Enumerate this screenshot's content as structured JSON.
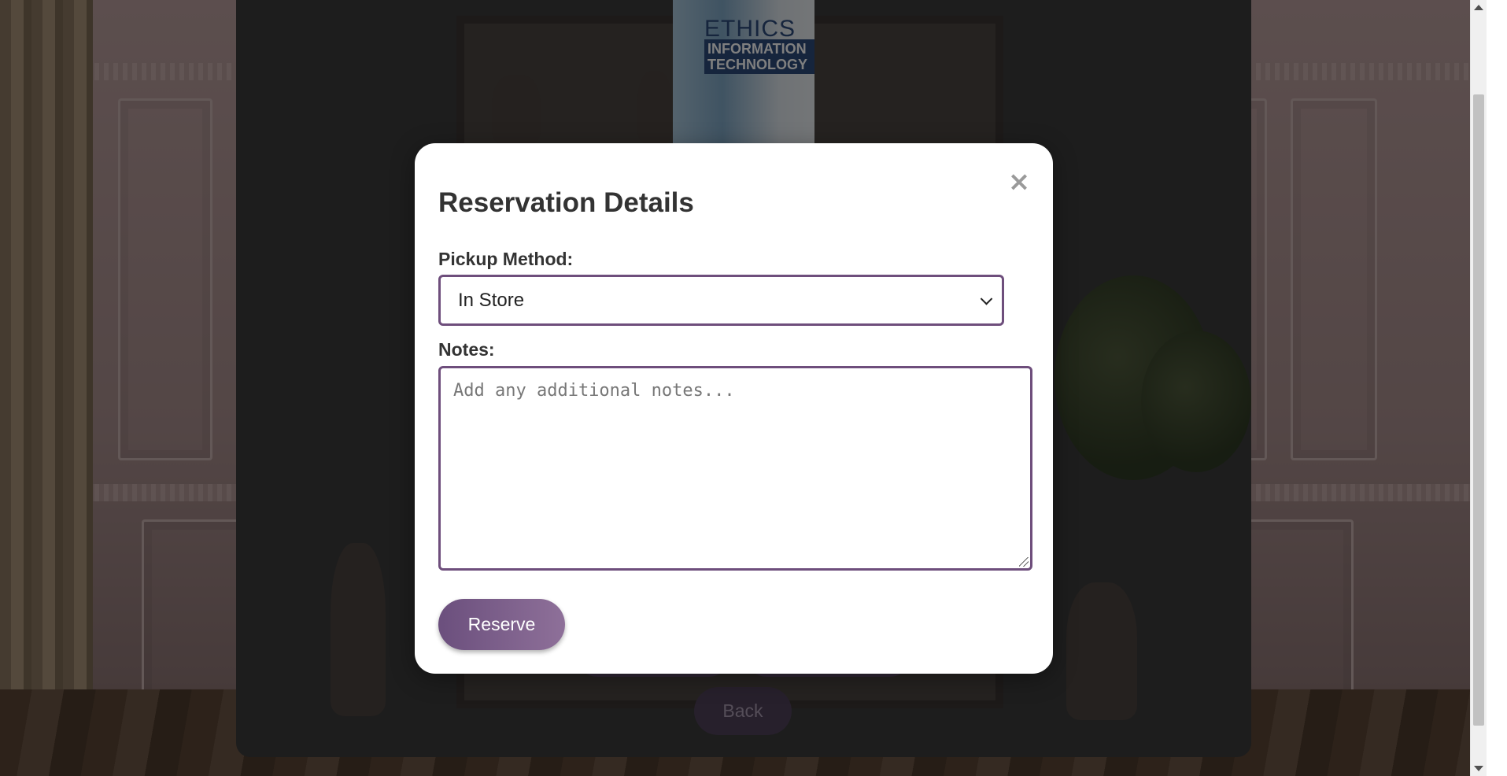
{
  "background": {
    "book_title_line1": "ETHICS IN",
    "book_title_line2": "INFORMATION TECHNOLOGY",
    "back_label": "Back"
  },
  "modal": {
    "title": "Reservation Details",
    "close_symbol": "×",
    "pickup": {
      "label": "Pickup Method:",
      "selected": "In Store"
    },
    "notes": {
      "label": "Notes:",
      "placeholder": "Add any additional notes...",
      "value": ""
    },
    "reserve_label": "Reserve"
  },
  "colors": {
    "accent": "#6e4e7c",
    "button_gradient_start": "#6b4f7d",
    "button_gradient_end": "#8e7099"
  }
}
